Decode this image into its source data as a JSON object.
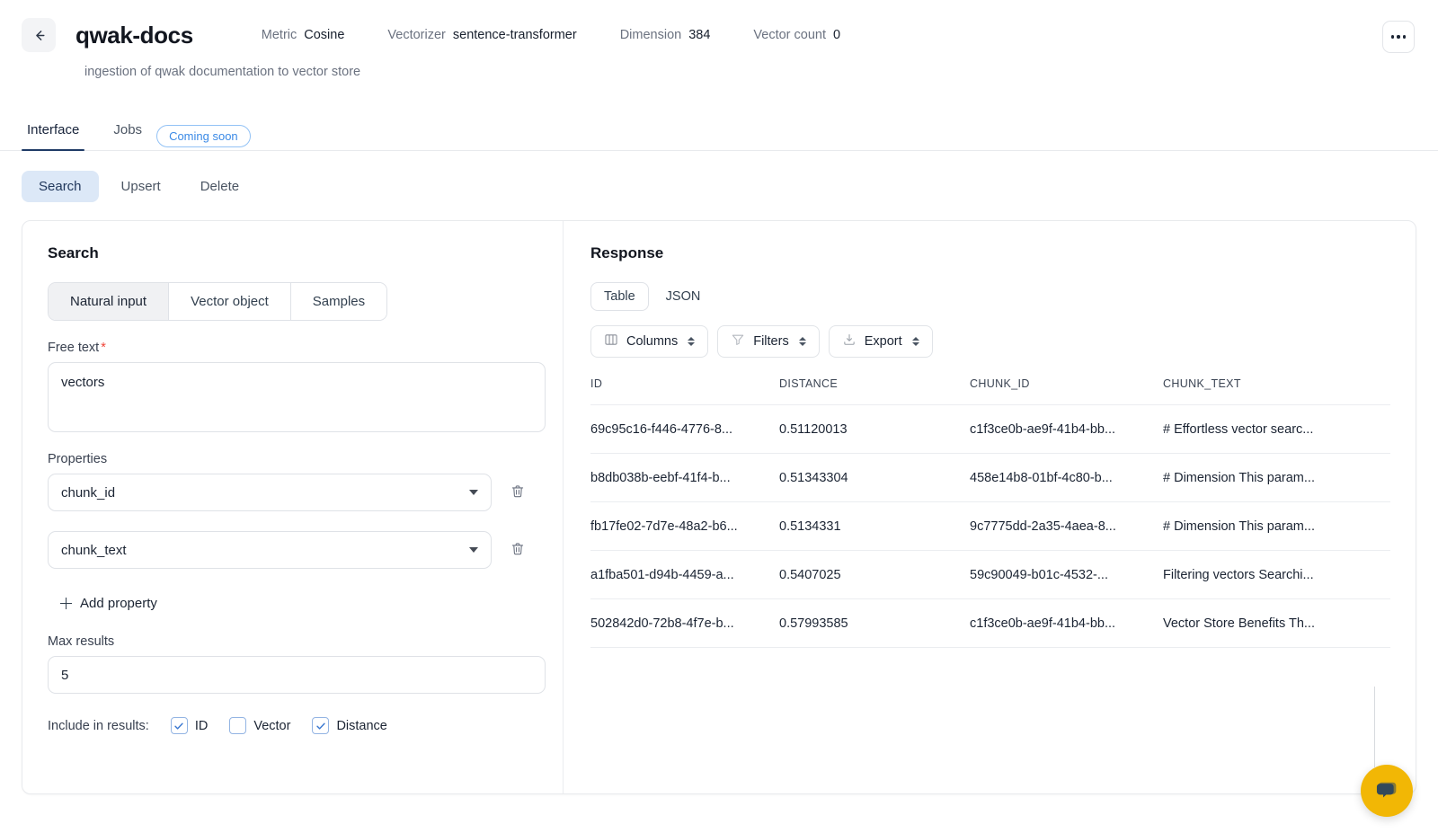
{
  "header": {
    "back_icon": "arrow-left-icon",
    "title": "qwak-docs",
    "subtitle": "ingestion of qwak documentation to vector store",
    "kebab_icon": "more-options-icon",
    "meta": [
      {
        "key": "Metric",
        "value": "Cosine"
      },
      {
        "key": "Vectorizer",
        "value": "sentence-transformer"
      },
      {
        "key": "Dimension",
        "value": "384"
      },
      {
        "key": "Vector count",
        "value": "0"
      }
    ]
  },
  "tabs": [
    {
      "label": "Interface",
      "active": true
    },
    {
      "label": "Jobs",
      "active": false
    }
  ],
  "badge": {
    "label": "Coming soon",
    "color": "#3b8ae6"
  },
  "subtabs": [
    {
      "label": "Search",
      "active": true
    },
    {
      "label": "Upsert",
      "active": false
    },
    {
      "label": "Delete",
      "active": false
    }
  ],
  "search": {
    "panel_title": "Search",
    "segments": [
      {
        "label": "Natural input",
        "active": true
      },
      {
        "label": "Vector object",
        "active": false
      },
      {
        "label": "Samples",
        "active": false
      }
    ],
    "free_text": {
      "label": "Free text",
      "required_marker": "*",
      "value": "vectors",
      "placeholder": ""
    },
    "properties": {
      "label": "Properties",
      "rows": [
        {
          "value": "chunk_id",
          "delete_icon": "trash-icon",
          "caret_icon": "chevron-down-icon"
        },
        {
          "value": "chunk_text",
          "delete_icon": "trash-icon",
          "caret_icon": "chevron-down-icon"
        }
      ],
      "add_label": "Add property",
      "add_icon": "plus-icon"
    },
    "max_results": {
      "label": "Max results",
      "value": "5",
      "placeholder": ""
    },
    "include": {
      "label": "Include in results:",
      "options": [
        {
          "label": "ID",
          "checked": true
        },
        {
          "label": "Vector",
          "checked": false
        },
        {
          "label": "Distance",
          "checked": true
        }
      ]
    }
  },
  "response": {
    "panel_title": "Response",
    "views": [
      {
        "label": "Table",
        "active": true
      },
      {
        "label": "JSON",
        "active": false
      }
    ],
    "toolbar": [
      {
        "label": "Columns",
        "icon": "columns-icon"
      },
      {
        "label": "Filters",
        "icon": "filter-icon"
      },
      {
        "label": "Export",
        "icon": "download-icon"
      }
    ],
    "table": {
      "columns": [
        "ID",
        "DISTANCE",
        "CHUNK_ID",
        "CHUNK_TEXT"
      ],
      "rows": [
        [
          "69c95c16-f446-4776-8...",
          "0.51120013",
          "c1f3ce0b-ae9f-41b4-bb...",
          "# Effortless vector searc..."
        ],
        [
          "b8db038b-eebf-41f4-b...",
          "0.51343304",
          "458e14b8-01bf-4c80-b...",
          "# Dimension This param..."
        ],
        [
          "fb17fe02-7d7e-48a2-b6...",
          "0.5134331",
          "9c7775dd-2a35-4aea-8...",
          "# Dimension This param..."
        ],
        [
          "a1fba501-d94b-4459-a...",
          "0.5407025",
          "59c90049-b01c-4532-...",
          "Filtering vectors Searchi..."
        ],
        [
          "502842d0-72b8-4f7e-b...",
          "0.57993585",
          "c1f3ce0b-ae9f-41b4-bb...",
          "Vector Store Benefits Th..."
        ]
      ]
    }
  },
  "chat_widget": {
    "icon": "chat-bubble-icon",
    "bg_color": "#f2b705",
    "bubble_color": "#33495a"
  }
}
